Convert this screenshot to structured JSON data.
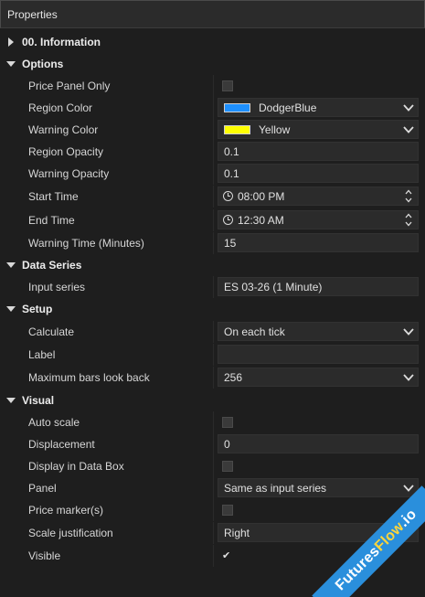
{
  "window": {
    "title": "Properties"
  },
  "watermark": {
    "part1": "Futures",
    "part2": "Flow",
    "part3": ".io"
  },
  "colors": {
    "dodger_blue": "#1e90ff",
    "yellow": "#ffff00",
    "watermark_bg": "#2a8fdc"
  },
  "categories": {
    "information": "00. Information",
    "options": "Options",
    "data_series": "Data Series",
    "setup": "Setup",
    "visual": "Visual"
  },
  "options": {
    "price_panel_only": {
      "label": "Price Panel Only",
      "checked": false
    },
    "region_color": {
      "label": "Region Color",
      "value": "DodgerBlue"
    },
    "warning_color": {
      "label": "Warning Color",
      "value": "Yellow"
    },
    "region_opacity": {
      "label": "Region Opacity",
      "value": "0.1"
    },
    "warning_opacity": {
      "label": "Warning Opacity",
      "value": "0.1"
    },
    "start_time": {
      "label": "Start Time",
      "value": "08:00 PM"
    },
    "end_time": {
      "label": "End Time",
      "value": "12:30 AM"
    },
    "warning_time": {
      "label": "Warning Time (Minutes)",
      "value": "15"
    }
  },
  "data_series": {
    "input_series": {
      "label": "Input series",
      "value": "ES 03-26 (1 Minute)"
    }
  },
  "setup": {
    "calculate": {
      "label": "Calculate",
      "value": "On each tick"
    },
    "label": {
      "label": "Label",
      "value": ""
    },
    "max_bars": {
      "label": "Maximum bars look back",
      "value": "256"
    }
  },
  "visual": {
    "auto_scale": {
      "label": "Auto scale",
      "checked": false
    },
    "displacement": {
      "label": "Displacement",
      "value": "0"
    },
    "display_in_data_box": {
      "label": "Display in Data Box",
      "checked": false
    },
    "panel": {
      "label": "Panel",
      "value": "Same as input series"
    },
    "price_markers": {
      "label": "Price marker(s)",
      "checked": false
    },
    "scale_justification": {
      "label": "Scale justification",
      "value": "Right"
    },
    "visible": {
      "label": "Visible",
      "checked": true
    }
  }
}
